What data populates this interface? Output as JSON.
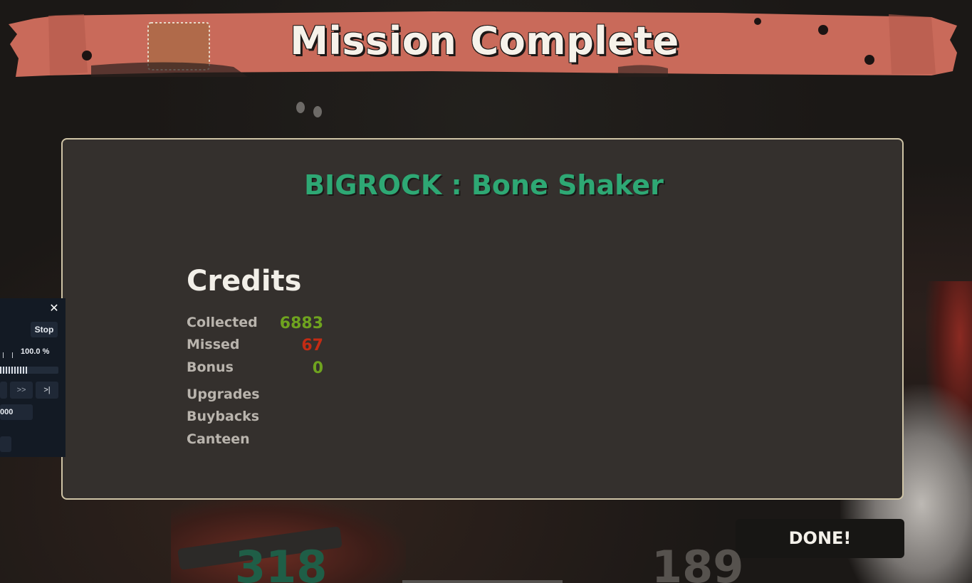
{
  "banner": {
    "title": "Mission Complete"
  },
  "mission": {
    "title": "BIGROCK : Bone Shaker"
  },
  "credits": {
    "heading": "Credits",
    "rows": [
      {
        "label": "Collected",
        "value": "6883",
        "color": "#6fa31f"
      },
      {
        "label": "Missed",
        "value": "67",
        "color": "#c42b14"
      },
      {
        "label": "Bonus",
        "value": "0",
        "color": "#6fa31f"
      }
    ],
    "extra_rows": [
      {
        "label": "Upgrades"
      },
      {
        "label": "Buybacks"
      },
      {
        "label": "Canteen"
      }
    ]
  },
  "done_button": {
    "label": "DONE!"
  },
  "scores": {
    "left": "318",
    "right": "189"
  },
  "playback": {
    "close_icon": "close-icon",
    "close_glyph": "✕",
    "stop_label": "Stop",
    "speed": "100.0 %",
    "progress": 0.48,
    "fast_forward_label": ">>",
    "end_label": ">|",
    "frame_value": "000"
  },
  "colors": {
    "banner": "#c96a5a",
    "panel_bg": "#34302d",
    "panel_border": "#cfc4a6",
    "mission_title": "#2ea874",
    "done_bg": "#171614"
  }
}
